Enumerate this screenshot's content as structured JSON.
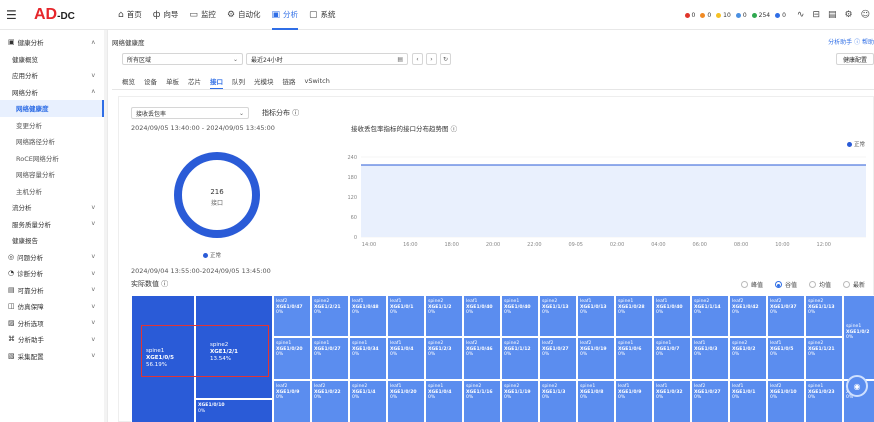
{
  "app": {
    "logo_main": "AD",
    "logo_suffix": "-DC"
  },
  "topnav": [
    {
      "label": "首页",
      "icon": "⌂",
      "active": false
    },
    {
      "label": "向导",
      "icon": "ф",
      "active": false
    },
    {
      "label": "监控",
      "icon": "▭",
      "active": false
    },
    {
      "label": "自动化",
      "icon": "⚙",
      "active": false
    },
    {
      "label": "分析",
      "icon": "▣",
      "active": true
    },
    {
      "label": "系统",
      "icon": "▢",
      "active": false
    }
  ],
  "alarms": [
    {
      "color": "#e0352b",
      "count": "0"
    },
    {
      "color": "#f08a24",
      "count": "0"
    },
    {
      "color": "#f5c023",
      "count": "10"
    },
    {
      "color": "#4a90e2",
      "count": "0"
    },
    {
      "color": "#2fa84f",
      "count": "254"
    },
    {
      "color": "#2f6ee6",
      "count": "0"
    }
  ],
  "sidebar": [
    {
      "label": "健康分析",
      "icon": "▣",
      "arrow": "ʌ",
      "level": 0,
      "active": false
    },
    {
      "label": "健康概览",
      "level": 1,
      "active": false
    },
    {
      "label": "应用分析",
      "arrow": "v",
      "level": 1,
      "active": false
    },
    {
      "label": "网络分析",
      "arrow": "ʌ",
      "level": 1,
      "active": false
    },
    {
      "label": "网络健康度",
      "level": 2,
      "active": true
    },
    {
      "label": "变更分析",
      "level": 2,
      "active": false
    },
    {
      "label": "网络路径分析",
      "level": 2,
      "active": false
    },
    {
      "label": "RoCE网络分析",
      "level": 2,
      "active": false
    },
    {
      "label": "网络容量分析",
      "level": 2,
      "active": false
    },
    {
      "label": "主机分析",
      "level": 2,
      "active": false
    },
    {
      "label": "流分析",
      "arrow": "v",
      "level": 1,
      "active": false
    },
    {
      "label": "服务质量分析",
      "arrow": "v",
      "level": 1,
      "active": false
    },
    {
      "label": "健康报告",
      "level": 1,
      "active": false
    },
    {
      "label": "问题分析",
      "icon": "◎",
      "arrow": "v",
      "level": 0,
      "active": false
    },
    {
      "label": "诊断分析",
      "icon": "◔",
      "arrow": "v",
      "level": 0,
      "active": false
    },
    {
      "label": "可靠分析",
      "icon": "▤",
      "arrow": "v",
      "level": 0,
      "active": false
    },
    {
      "label": "仿真保障",
      "icon": "◫",
      "arrow": "v",
      "level": 0,
      "active": false
    },
    {
      "label": "分析选项",
      "icon": "▨",
      "arrow": "v",
      "level": 0,
      "active": false
    },
    {
      "label": "分析助手",
      "icon": "⌘",
      "arrow": "v",
      "level": 0,
      "active": false
    },
    {
      "label": "采集配置",
      "icon": "▧",
      "arrow": "v",
      "level": 0,
      "active": false
    }
  ],
  "main": {
    "breadcrumb": "网络健康度",
    "helper": "分析助手 ⓘ 帮助",
    "region_select": "所有区域",
    "time_select": "最近24小时",
    "config_button": "健康配置",
    "tabs": [
      "概览",
      "设备",
      "单板",
      "芯片",
      "接口",
      "队列",
      "光模块",
      "链路",
      "vSwitch"
    ],
    "active_tab": 4
  },
  "panel": {
    "metric_select": "接收丢包率",
    "dist_label": "指标分布 ⓘ",
    "range1": "2024/09/05 13:40:00 - 2024/09/05 13:45:00",
    "donut_value": "216",
    "donut_unit": "接口",
    "donut_legend": "正常",
    "chart_title": "接收丢包率指标的接口分布趋势图  ⓘ",
    "chart_legend": "正常",
    "range2": "2024/09/04 13:55:00-2024/09/05 13:45:00",
    "actual_label": "实际数值  ⓘ",
    "radios": [
      "峰值",
      "谷值",
      "均值",
      "最新"
    ],
    "radio_selected": 1
  },
  "colors": {
    "accent": "#2f6ee6",
    "tile": "#5b8def",
    "tile_big": "#2a5bd7",
    "highlight": "#e03535"
  },
  "chart_data": [
    {
      "type": "pie",
      "values": [
        216
      ],
      "categories": [
        "正常"
      ],
      "title": ""
    },
    {
      "type": "line",
      "title": "接收丢包率指标的接口分布趋势图",
      "x": [
        "14:00",
        "16:00",
        "18:00",
        "20:00",
        "22:00",
        "09-05",
        "02:00",
        "04:00",
        "06:00",
        "08:00",
        "10:00",
        "12:00"
      ],
      "series": [
        {
          "name": "正常",
          "values": [
            216,
            216,
            216,
            216,
            216,
            216,
            216,
            216,
            216,
            216,
            216,
            216
          ]
        }
      ],
      "yticks": [
        0,
        60,
        120,
        180,
        240
      ],
      "ylim": [
        0,
        240
      ],
      "grid": true,
      "legend": "top-right"
    }
  ],
  "treemap": {
    "big": [
      {
        "l1": "spine1",
        "l2": "XGE1/0/5",
        "l3": "56.19%"
      },
      {
        "l1": "spine2",
        "l2": "XGE1/2/1",
        "l3": "13.54%"
      }
    ],
    "rows": [
      [
        {
          "l1": "leaf2",
          "l2": "XGE1/0/47",
          "l3": "0%"
        },
        {
          "l1": "spine2",
          "l2": "XGE1/2/21",
          "l3": "0%"
        },
        {
          "l1": "leaf1",
          "l2": "XGE1/0/48",
          "l3": "0%"
        },
        {
          "l1": "leaf1",
          "l2": "XGE1/0/1",
          "l3": "0%"
        },
        {
          "l1": "spine2",
          "l2": "XGE1/1/2",
          "l3": "0%"
        },
        {
          "l1": "leaf1",
          "l2": "XGE1/0/40",
          "l3": "0%"
        },
        {
          "l1": "spine1",
          "l2": "XGE1/0/40",
          "l3": "0%"
        },
        {
          "l1": "spine2",
          "l2": "XGE1/1/13",
          "l3": "0%"
        },
        {
          "l1": "leaf1",
          "l2": "XGE1/0/13",
          "l3": "0%"
        },
        {
          "l1": "spine1",
          "l2": "XGE1/0/28",
          "l3": "0%"
        },
        {
          "l1": "leaf1",
          "l2": "XGE1/0/40",
          "l3": "0%"
        },
        {
          "l1": "spine2",
          "l2": "XGE1/1/14",
          "l3": "0%"
        },
        {
          "l1": "leaf2",
          "l2": "XGE1/0/42",
          "l3": "0%"
        },
        {
          "l1": "leaf2",
          "l2": "XGE1/0/37",
          "l3": "0%"
        },
        {
          "l1": "spine2",
          "l2": "XGE1/1/13",
          "l3": "0%"
        }
      ],
      [
        {
          "l1": "spine1",
          "l2": "XGE1/0/20",
          "l3": "0%"
        },
        {
          "l1": "spine1",
          "l2": "XGE1/0/27",
          "l3": "0%"
        },
        {
          "l1": "spine1",
          "l2": "XGE1/0/34",
          "l3": "0%"
        },
        {
          "l1": "leaf1",
          "l2": "XGE1/0/4",
          "l3": "0%"
        },
        {
          "l1": "spine2",
          "l2": "XGE1/2/3",
          "l3": "0%"
        },
        {
          "l1": "leaf2",
          "l2": "XGE1/0/46",
          "l3": "0%"
        },
        {
          "l1": "spine2",
          "l2": "XGE1/1/12",
          "l3": "0%"
        },
        {
          "l1": "leaf2",
          "l2": "XGE1/0/27",
          "l3": "0%"
        },
        {
          "l1": "leaf2",
          "l2": "XGE1/0/19",
          "l3": "0%"
        },
        {
          "l1": "spine1",
          "l2": "XGE1/0/6",
          "l3": "0%"
        },
        {
          "l1": "spine1",
          "l2": "XGE1/0/7",
          "l3": "0%"
        },
        {
          "l1": "leaf1",
          "l2": "XGE1/0/3",
          "l3": "0%"
        },
        {
          "l1": "spine2",
          "l2": "XGE1/0/2",
          "l3": "0%"
        },
        {
          "l1": "leaf1",
          "l2": "XGE1/0/5",
          "l3": "0%"
        },
        {
          "l1": "spine2",
          "l2": "XGE1/1/21",
          "l3": "0%"
        }
      ],
      [
        {
          "l1": "leaf2",
          "l2": "XGE1/0/9",
          "l3": "0%"
        },
        {
          "l1": "leaf2",
          "l2": "XGE1/0/22",
          "l3": "0%"
        },
        {
          "l1": "spine2",
          "l2": "XGE1/1/4",
          "l3": "0%"
        },
        {
          "l1": "leaf1",
          "l2": "XGE1/0/20",
          "l3": "0%"
        },
        {
          "l1": "spine1",
          "l2": "XGE1/0/4",
          "l3": "0%"
        },
        {
          "l1": "spine2",
          "l2": "XGE1/1/16",
          "l3": "0%"
        },
        {
          "l1": "spine2",
          "l2": "XGE1/1/19",
          "l3": "0%"
        },
        {
          "l1": "spine2",
          "l2": "XGE1/1/3",
          "l3": "0%"
        },
        {
          "l1": "spine1",
          "l2": "XGE1/0/8",
          "l3": "0%"
        },
        {
          "l1": "leaf1",
          "l2": "XGE1/0/9",
          "l3": "0%"
        },
        {
          "l1": "leaf1",
          "l2": "XGE1/0/32",
          "l3": "0%"
        },
        {
          "l1": "leaf2",
          "l2": "XGE1/0/27",
          "l3": "0%"
        },
        {
          "l1": "leaf1",
          "l2": "XGE1/0/1",
          "l3": "0%"
        },
        {
          "l1": "leaf2",
          "l2": "XGE1/0/10",
          "l3": "0%"
        },
        {
          "l1": "spine1",
          "l2": "XGE1/0/23",
          "l3": "0%"
        }
      ]
    ],
    "right_col": [
      {
        "l1": "spine1",
        "l2": "XGE1/0/2",
        "l3": "0%"
      },
      {
        "l1": "spine1",
        "l2": "XGE1",
        "l3": "0%"
      }
    ],
    "extra": {
      "l1": "",
      "l2": "XGE1/0/10",
      "l3": "0%"
    }
  }
}
